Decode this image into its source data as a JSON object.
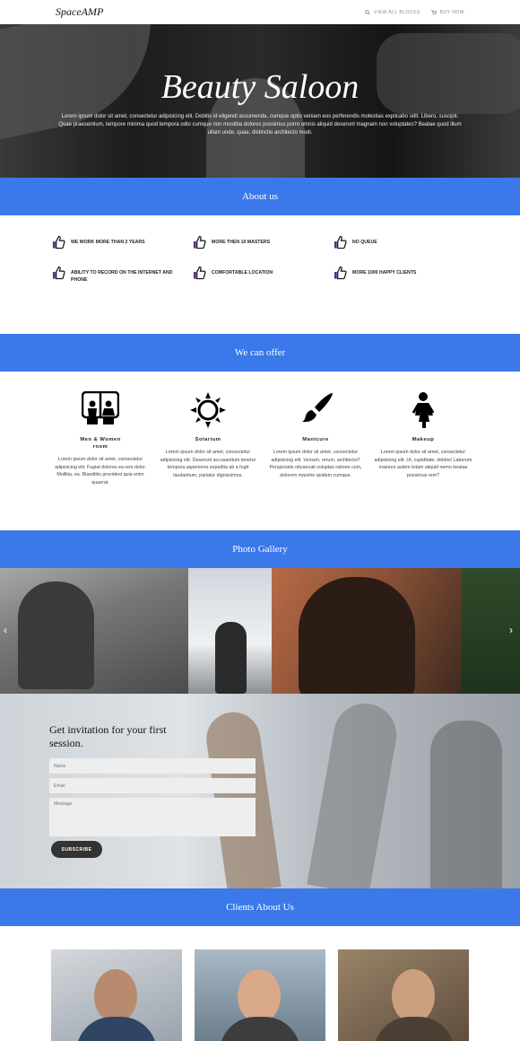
{
  "header": {
    "logo": "SpaceAMP",
    "nav": [
      {
        "label": "VIEW ALL BLOCKS",
        "icon": "search-icon"
      },
      {
        "label": "BUY NOW",
        "icon": "cart-icon"
      }
    ]
  },
  "hero": {
    "title": "Beauty Saloon",
    "text": "Lorem ipsum dolor sit amet, consectetur adipisicing elit. Debitis id eligendi assumenda, cumque optio veniam eos perferendis molestias explicabo odit. Libero, suscipit. Quae praesentium, tempore minima quod tempora odio cumque non mostiba dolores possimus porro omnis aliquid deserunt magnam non voluptates? Beatae quod illum ullam unde, quae, distinctio architecto modi."
  },
  "about": {
    "title": "About us",
    "features": [
      "WE WORK MORE THAN 2 YEARS",
      "MORE THEN 10 MASTERS",
      "NO QUEUE",
      "ABILITY TO RECORD ON THE INTERNET AND PHONE",
      "COMFORTABLE LOCATION",
      "MORE 1000 HAPPY CLIENTS"
    ]
  },
  "offer": {
    "title": "We can offer",
    "items": [
      {
        "title": "Men & Women room",
        "icon": "restroom-icon",
        "text": "Lorem ipsum dolor sit amet, consectetur adipisicing elit. Fugiat dolores ea rem dolor. Mollitia, ea. Blanditiis provident quia enim quaerat."
      },
      {
        "title": "Solarium",
        "icon": "sun-icon",
        "text": "Lorem ipsum dolor sit amet, consectetur adipisicing elit. Deserunt accusantium tenetur tempora asperiores expedita ab a fugit laudantium, pariatur dignissimos."
      },
      {
        "title": "Manicure",
        "icon": "brush-icon",
        "text": "Lorem ipsum dolor sit amet, consectetur adipisicing elit. Veniam, rerum, architecto? Perspiciatis obcaecati voluptas ratione cum, dolorem maxime quidem cumque."
      },
      {
        "title": "Makeup",
        "icon": "woman-icon",
        "text": "Lorem ipsum dolor sit amet, consectetur adipisicing elit. Ut, cupiditate, debitis! Laborum maiores autem totam aliquid nemo beatae possimus rem?"
      }
    ]
  },
  "gallery": {
    "title": "Photo Gallery",
    "prev": "‹",
    "next": "›"
  },
  "invite": {
    "title": "Get invitation for your first session.",
    "name_placeholder": "Name",
    "email_placeholder": "Email",
    "message_placeholder": "Message",
    "button": "SUBSCRIBE"
  },
  "clients": {
    "title": "Clients About Us"
  },
  "colors": {
    "accent": "#3b79ea",
    "icon_purple": "#5b2a86"
  }
}
